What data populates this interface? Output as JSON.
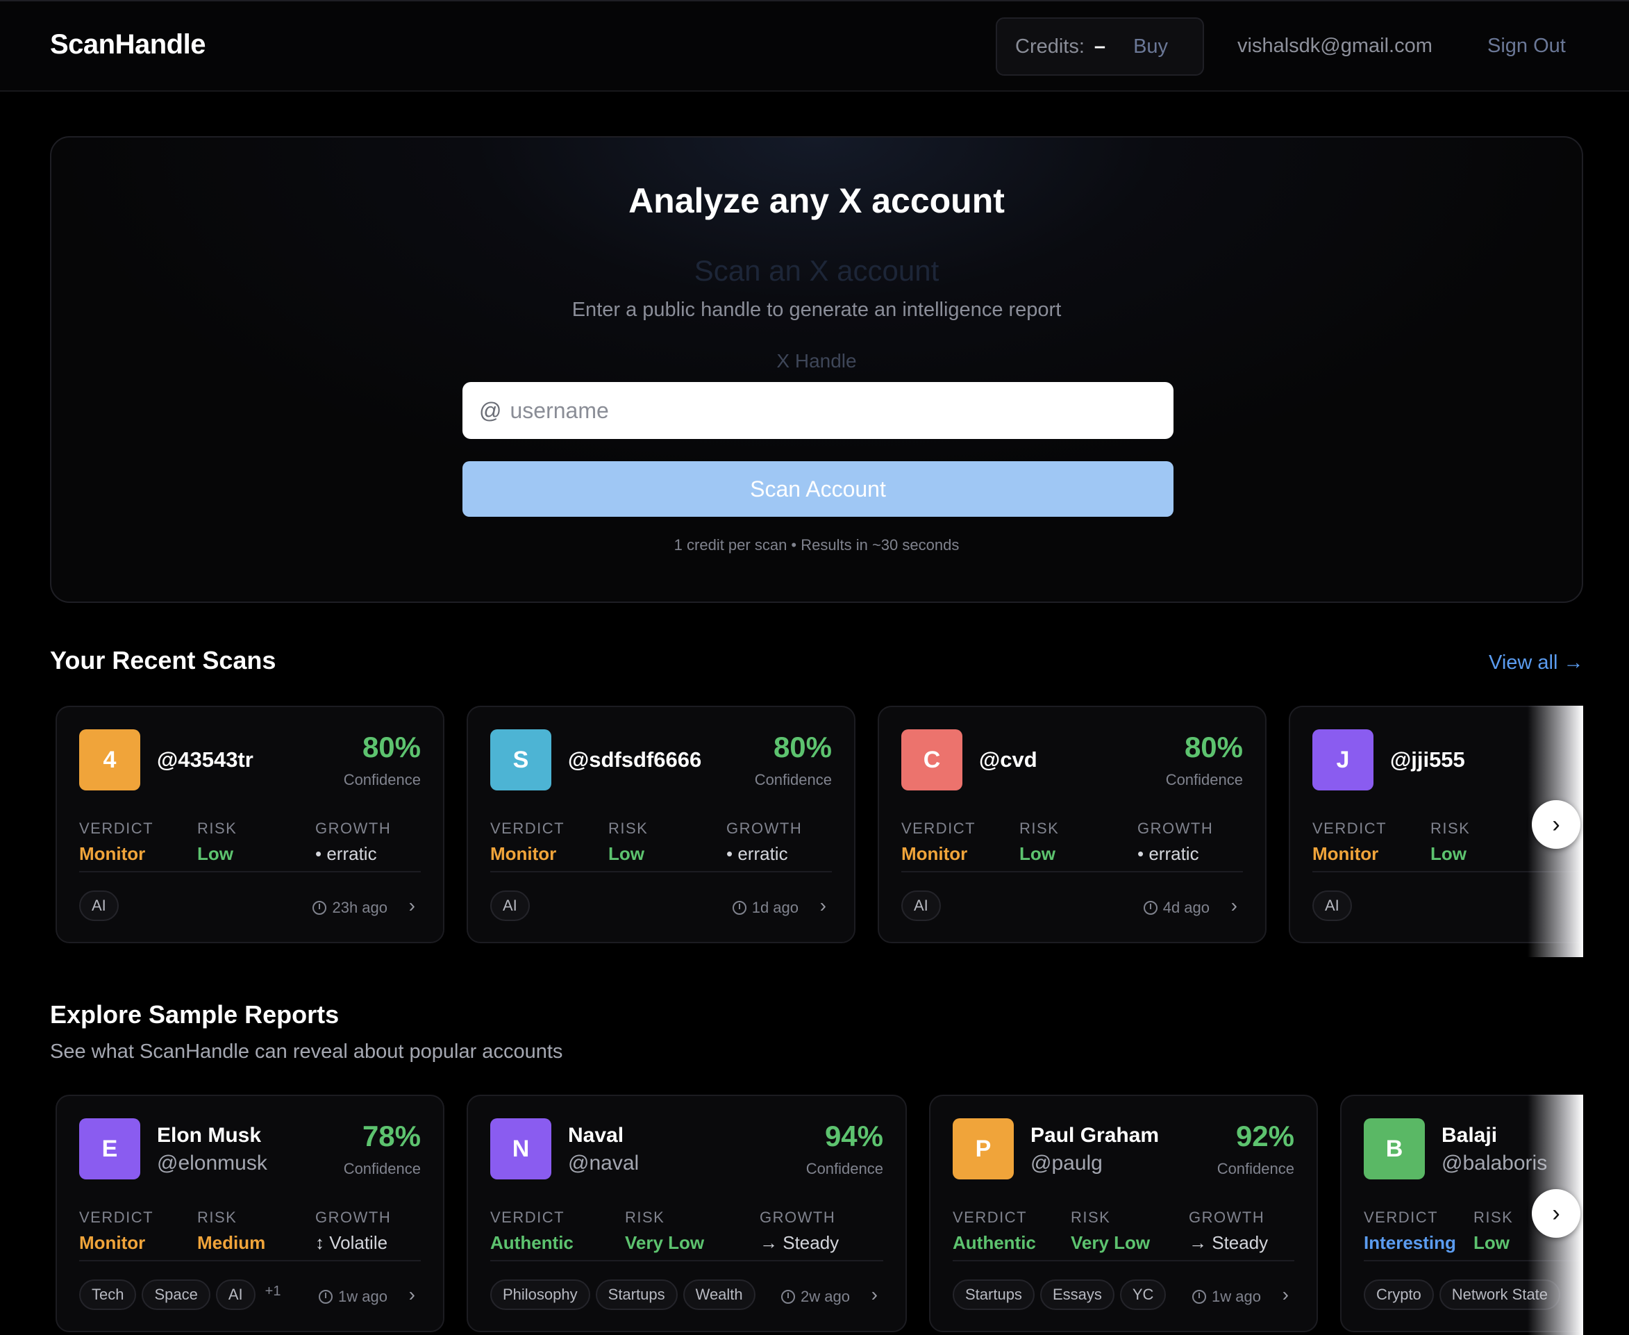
{
  "header": {
    "brand": "ScanHandle",
    "credits_label": "Credits:",
    "credits_value": "–",
    "buy_label": "Buy",
    "user_email": "vishalsdk@gmail.com",
    "signout_label": "Sign Out"
  },
  "hero": {
    "title": "Analyze any X account",
    "ghost_title": "Scan an X account",
    "subtitle": "Enter a public handle to generate an intelligence report",
    "field_label": "X Handle",
    "at_sign": "@",
    "input_placeholder": "username",
    "input_value": "",
    "scan_button": "Scan Account",
    "note": "1 credit per scan • Results in ~30 seconds"
  },
  "recent": {
    "title": "Your Recent Scans",
    "view_all": "View all →",
    "confidence_label": "Confidence",
    "verdict_label": "VERDICT",
    "risk_label": "RISK",
    "growth_label": "GROWTH",
    "cards": [
      {
        "initial": "4",
        "avatar_color": "#f0a43a",
        "handle": "@43543tr",
        "confidence": "80%",
        "verdict": "Monitor",
        "verdict_color": "#f0a43a",
        "risk": "Low",
        "risk_color": "#5dc36f",
        "growth": "• erratic",
        "tags": [
          "AI"
        ],
        "time": "23h ago"
      },
      {
        "initial": "S",
        "avatar_color": "#4db4d4",
        "handle": "@sdfsdf6666",
        "confidence": "80%",
        "verdict": "Monitor",
        "verdict_color": "#f0a43a",
        "risk": "Low",
        "risk_color": "#5dc36f",
        "growth": "• erratic",
        "tags": [
          "AI"
        ],
        "time": "1d ago"
      },
      {
        "initial": "C",
        "avatar_color": "#ec736d",
        "handle": "@cvd",
        "confidence": "80%",
        "verdict": "Monitor",
        "verdict_color": "#f0a43a",
        "risk": "Low",
        "risk_color": "#5dc36f",
        "growth": "• erratic",
        "tags": [
          "AI"
        ],
        "time": "4d ago"
      },
      {
        "initial": "J",
        "avatar_color": "#8a5cf0",
        "handle": "@jji555",
        "verdict": "Monitor",
        "verdict_color": "#f0a43a",
        "risk": "Low",
        "risk_color": "#5dc36f",
        "tags": [
          "AI"
        ]
      }
    ],
    "next_arrow": "›"
  },
  "samples": {
    "title": "Explore Sample Reports",
    "subtitle": "See what ScanHandle can reveal about popular accounts",
    "cards": [
      {
        "initial": "E",
        "avatar_color": "#8a5cf0",
        "name": "Elon Musk",
        "handle": "@elonmusk",
        "confidence": "78%",
        "verdict": "Monitor",
        "verdict_color": "#f0a43a",
        "risk": "Medium",
        "risk_color": "#f0a43a",
        "growth": "↕ Volatile",
        "tags": [
          "Tech",
          "Space",
          "AI"
        ],
        "more_tags": "+1",
        "time": "1w ago"
      },
      {
        "initial": "N",
        "avatar_color": "#8a5cf0",
        "name": "Naval",
        "handle": "@naval",
        "confidence": "94%",
        "verdict": "Authentic",
        "verdict_color": "#5dc36f",
        "risk": "Very Low",
        "risk_color": "#5dc36f",
        "growth": "→ Steady",
        "tags": [
          "Philosophy",
          "Startups",
          "Wealth"
        ],
        "time": "2w ago"
      },
      {
        "initial": "P",
        "avatar_color": "#f0a43a",
        "name": "Paul Graham",
        "handle": "@paulg",
        "confidence": "92%",
        "verdict": "Authentic",
        "verdict_color": "#5dc36f",
        "risk": "Very Low",
        "risk_color": "#5dc36f",
        "growth": "→ Steady",
        "tags": [
          "Startups",
          "Essays",
          "YC"
        ],
        "time": "1w ago"
      },
      {
        "initial": "B",
        "avatar_color": "#5ab865",
        "name": "Balaji",
        "handle": "@balaboris",
        "verdict": "Interesting",
        "verdict_color": "#5b9cf0",
        "risk": "Low",
        "risk_color": "#5dc36f",
        "tags": [
          "Crypto",
          "Network State"
        ]
      }
    ],
    "next_arrow": "›"
  }
}
